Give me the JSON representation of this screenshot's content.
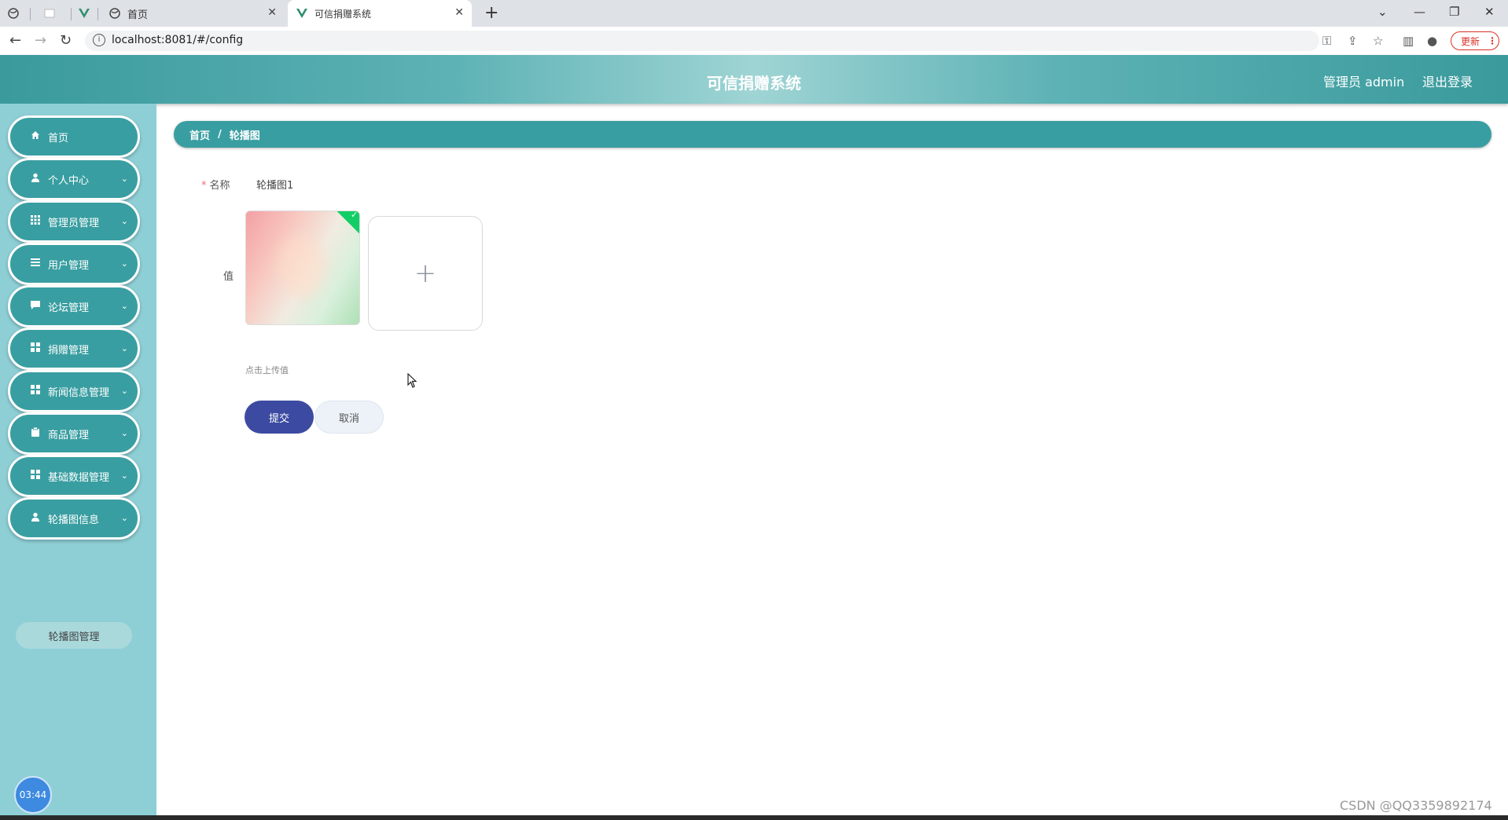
{
  "browser": {
    "tabs": [
      {
        "title": "",
        "icon": "globe-icon"
      },
      {
        "title": "",
        "icon": "blank-icon"
      },
      {
        "title": "",
        "icon": "vue-icon"
      },
      {
        "title": "首页",
        "icon": "globe-icon"
      },
      {
        "title": "可信捐赠系统",
        "icon": "vue-icon"
      }
    ],
    "url": "localhost:8081/#/config",
    "update_label": "更新"
  },
  "header": {
    "title": "可信捐赠系统",
    "user": "管理员 admin",
    "logout": "退出登录"
  },
  "sidebar": {
    "items": [
      {
        "label": "首页",
        "icon": "home-icon"
      },
      {
        "label": "个人中心",
        "icon": "user-icon"
      },
      {
        "label": "管理员管理",
        "icon": "grid-icon"
      },
      {
        "label": "用户管理",
        "icon": "list-icon"
      },
      {
        "label": "论坛管理",
        "icon": "chat-icon"
      },
      {
        "label": "捐赠管理",
        "icon": "grid-icon"
      },
      {
        "label": "新闻信息管理",
        "icon": "grid-icon"
      },
      {
        "label": "商品管理",
        "icon": "clipboard-icon"
      },
      {
        "label": "基础数据管理",
        "icon": "grid-icon"
      },
      {
        "label": "轮播图信息",
        "icon": "user-icon"
      }
    ],
    "submenu": {
      "label": "轮播图管理"
    },
    "timer": "03:44"
  },
  "breadcrumb": {
    "home": "首页",
    "separator": "/",
    "current": "轮播图"
  },
  "form": {
    "name_label": "名称",
    "name_value": "轮播图1",
    "value_label": "值",
    "upload_hint": "点击上传值",
    "submit": "提交",
    "cancel": "取消"
  },
  "watermark": "CSDN @QQ3359892174"
}
